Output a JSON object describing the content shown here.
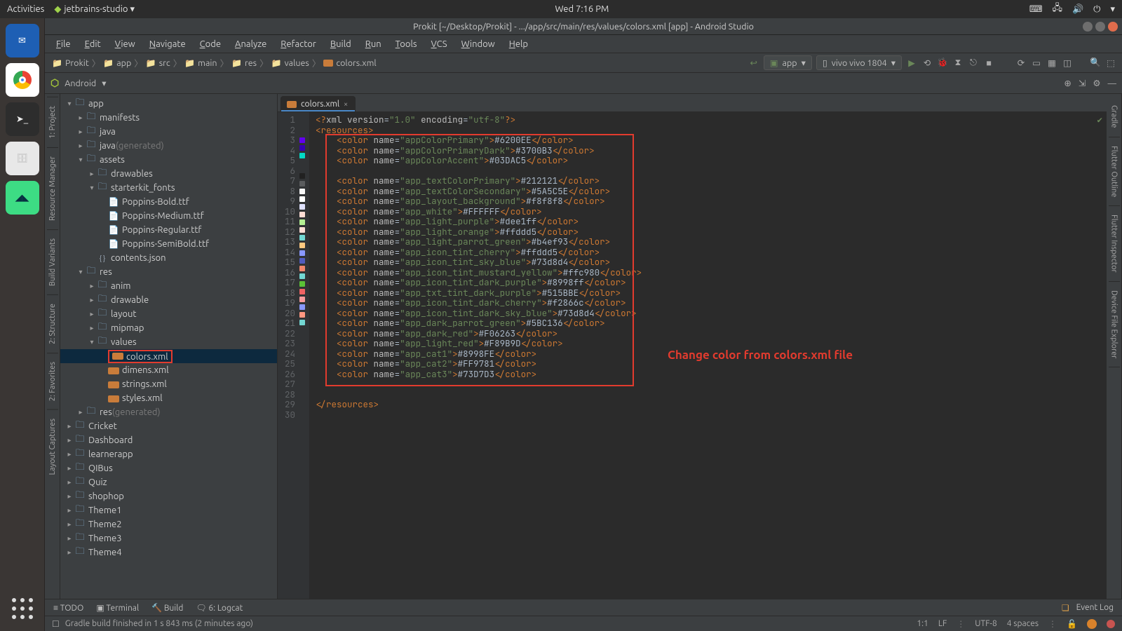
{
  "os": {
    "activities": "Activities",
    "app_menu": "jetbrains-studio ▾",
    "clock": "Wed  7:16 PM"
  },
  "launcher": {
    "items": [
      {
        "name": "thunderbird-icon"
      },
      {
        "name": "chrome-icon"
      },
      {
        "name": "terminal-icon"
      },
      {
        "name": "files-icon"
      },
      {
        "name": "android-studio-icon"
      }
    ]
  },
  "title": "Prokit [~/Desktop/Prokit] - .../app/src/main/res/values/colors.xml [app] - Android Studio",
  "menus": [
    "File",
    "Edit",
    "View",
    "Navigate",
    "Code",
    "Analyze",
    "Refactor",
    "Build",
    "Run",
    "Tools",
    "VCS",
    "Window",
    "Help"
  ],
  "breadcrumbs": [
    "Prokit",
    "app",
    "src",
    "main",
    "res",
    "values",
    "colors.xml"
  ],
  "run_config": {
    "module": "app",
    "device": "vivo vivo 1804"
  },
  "module_bar": {
    "label": "Android",
    "dropdown": "▾"
  },
  "tree": [
    {
      "d": 0,
      "a": "▾",
      "t": "folder",
      "l": "app"
    },
    {
      "d": 1,
      "a": "▸",
      "t": "folder",
      "l": "manifests"
    },
    {
      "d": 1,
      "a": "▸",
      "t": "folder",
      "l": "java"
    },
    {
      "d": 1,
      "a": "▸",
      "t": "folder",
      "l": "java",
      "m": "(generated)"
    },
    {
      "d": 1,
      "a": "▾",
      "t": "folder",
      "l": "assets"
    },
    {
      "d": 2,
      "a": "▸",
      "t": "folder",
      "l": "drawables"
    },
    {
      "d": 2,
      "a": "▾",
      "t": "folder",
      "l": "starterkit_fonts"
    },
    {
      "d": 3,
      "a": "",
      "t": "file",
      "l": "Poppins-Bold.ttf"
    },
    {
      "d": 3,
      "a": "",
      "t": "file",
      "l": "Poppins-Medium.ttf"
    },
    {
      "d": 3,
      "a": "",
      "t": "file",
      "l": "Poppins-Regular.ttf"
    },
    {
      "d": 3,
      "a": "",
      "t": "file",
      "l": "Poppins-SemiBold.ttf"
    },
    {
      "d": 2,
      "a": "",
      "t": "json",
      "l": "contents.json"
    },
    {
      "d": 1,
      "a": "▾",
      "t": "folder",
      "l": "res"
    },
    {
      "d": 2,
      "a": "▸",
      "t": "folder",
      "l": "anim"
    },
    {
      "d": 2,
      "a": "▸",
      "t": "folder",
      "l": "drawable"
    },
    {
      "d": 2,
      "a": "▸",
      "t": "folder",
      "l": "layout"
    },
    {
      "d": 2,
      "a": "▸",
      "t": "folder",
      "l": "mipmap"
    },
    {
      "d": 2,
      "a": "▾",
      "t": "folder",
      "l": "values"
    },
    {
      "d": 3,
      "a": "",
      "t": "xml",
      "l": "colors.xml",
      "sel": true,
      "box": true
    },
    {
      "d": 3,
      "a": "",
      "t": "xml",
      "l": "dimens.xml"
    },
    {
      "d": 3,
      "a": "",
      "t": "xml",
      "l": "strings.xml"
    },
    {
      "d": 3,
      "a": "",
      "t": "xml",
      "l": "styles.xml"
    },
    {
      "d": 1,
      "a": "▸",
      "t": "folder",
      "l": "res",
      "m": "(generated)"
    },
    {
      "d": 0,
      "a": "▸",
      "t": "folder",
      "l": "Cricket"
    },
    {
      "d": 0,
      "a": "▸",
      "t": "folder",
      "l": "Dashboard"
    },
    {
      "d": 0,
      "a": "▸",
      "t": "folder",
      "l": "learnerapp"
    },
    {
      "d": 0,
      "a": "▸",
      "t": "folder",
      "l": "QIBus"
    },
    {
      "d": 0,
      "a": "▸",
      "t": "folder",
      "l": "Quiz"
    },
    {
      "d": 0,
      "a": "▸",
      "t": "folder",
      "l": "shophop"
    },
    {
      "d": 0,
      "a": "▸",
      "t": "folder",
      "l": "Theme1"
    },
    {
      "d": 0,
      "a": "▸",
      "t": "folder",
      "l": "Theme2"
    },
    {
      "d": 0,
      "a": "▸",
      "t": "folder",
      "l": "Theme3"
    },
    {
      "d": 0,
      "a": "▸",
      "t": "folder",
      "l": "Theme4"
    }
  ],
  "tab": {
    "label": "colors.xml"
  },
  "code_lines": [
    {
      "n": 1,
      "c": null,
      "xml_decl": true
    },
    {
      "n": 2,
      "c": null,
      "open": "resources"
    },
    {
      "n": 3,
      "c": "#6200EE",
      "name": "appColorPrimary",
      "val": "#6200EE"
    },
    {
      "n": 4,
      "c": "#3700B3",
      "name": "appColorPrimaryDark",
      "val": "#3700B3"
    },
    {
      "n": 5,
      "c": "#03DAC5",
      "name": "appColorAccent",
      "val": "#03DAC5"
    },
    {
      "n": 6,
      "c": null,
      "blank": true
    },
    {
      "n": 7,
      "c": "#212121",
      "name": "app_textColorPrimary",
      "val": "#212121"
    },
    {
      "n": 8,
      "c": "#5A5C5E",
      "name": "app_textColorSecondary",
      "val": "#5A5C5E"
    },
    {
      "n": 9,
      "c": "#f8f8f8",
      "name": "app_layout_background",
      "val": "#f8f8f8"
    },
    {
      "n": 10,
      "c": "#FFFFFF",
      "name": "app_white",
      "val": "#FFFFFF"
    },
    {
      "n": 11,
      "c": "#dee1ff",
      "name": "app_light_purple",
      "val": "#dee1ff"
    },
    {
      "n": 12,
      "c": "#ffddd5",
      "name": "app_light_orange",
      "val": "#ffddd5"
    },
    {
      "n": 13,
      "c": "#b4ef93",
      "name": "app_light_parrot_green",
      "val": "#b4ef93"
    },
    {
      "n": 14,
      "c": "#ffddd5",
      "name": "app_icon_tint_cherry",
      "val": "#ffddd5"
    },
    {
      "n": 15,
      "c": "#73d8d4",
      "name": "app_icon_tint_sky_blue",
      "val": "#73d8d4"
    },
    {
      "n": 16,
      "c": "#ffc980",
      "name": "app_icon_tint_mustard_yellow",
      "val": "#ffc980"
    },
    {
      "n": 17,
      "c": "#8998ff",
      "name": "app_icon_tint_dark_purple",
      "val": "#8998ff"
    },
    {
      "n": 18,
      "c": "#515BBE",
      "name": "app_txt_tint_dark_purple",
      "val": "#515BBE"
    },
    {
      "n": 19,
      "c": "#f2866c",
      "name": "app_icon_tint_dark_cherry",
      "val": "#f2866c"
    },
    {
      "n": 20,
      "c": "#73d8d4",
      "name": "app_icon_tint_dark_sky_blue",
      "val": "#73d8d4"
    },
    {
      "n": 21,
      "c": "#5BC136",
      "name": "app_dark_parrot_green",
      "val": "#5BC136"
    },
    {
      "n": 22,
      "c": "#F06263",
      "name": "app_dark_red",
      "val": "#F06263"
    },
    {
      "n": 23,
      "c": "#F89B9D",
      "name": "app_light_red",
      "val": "#F89B9D"
    },
    {
      "n": 24,
      "c": "#8998FE",
      "name": "app_cat1",
      "val": "#8998FE"
    },
    {
      "n": 25,
      "c": "#FF9781",
      "name": "app_cat2",
      "val": "#FF9781"
    },
    {
      "n": 26,
      "c": "#73D7D3",
      "name": "app_cat3",
      "val": "#73D7D3"
    },
    {
      "n": 27,
      "c": null,
      "blank": true
    },
    {
      "n": 28,
      "c": null,
      "blank": true
    },
    {
      "n": 29,
      "c": null,
      "close": "resources"
    },
    {
      "n": 30,
      "c": null,
      "blank": true
    }
  ],
  "annotation": "Change color from colors.xml file",
  "left_tool_tabs": [
    "1: Project",
    "Resource Manager",
    "Build Variants",
    "2: Structure",
    "2: Favorites",
    "Layout Captures"
  ],
  "right_tool_tabs": [
    "Gradle",
    "Flutter Outline",
    "Flutter Inspector",
    "Device File Explorer"
  ],
  "bottom_tabs": {
    "left": [
      "≡ TODO",
      "▣ Terminal",
      "🔨 Build",
      "🗨 6: Logcat"
    ],
    "right": "Event Log"
  },
  "status": {
    "msg": "Gradle build finished in 1 s 843 ms (2 minutes ago)",
    "pos": "1:1",
    "lf": "LF",
    "enc": "UTF-8",
    "indent": "4 spaces"
  }
}
